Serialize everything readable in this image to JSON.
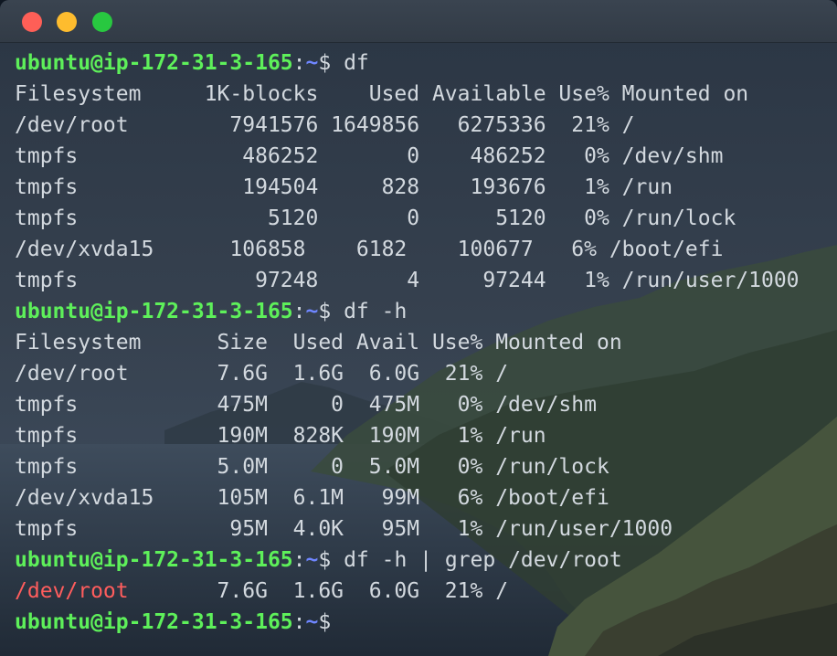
{
  "window": {
    "buttons": [
      "close",
      "minimize",
      "maximize"
    ],
    "colors": {
      "close": "#fe5f57",
      "minimize": "#febc2e",
      "maximize": "#28c840"
    }
  },
  "colors": {
    "prompt_user": "#5ef05a",
    "prompt_path": "#6f86ff",
    "text": "#d3d9df",
    "grep_match": "#ff5d5d"
  },
  "prompt": {
    "user_host": "ubuntu@ip-172-31-3-165",
    "colon": ":",
    "path": "~",
    "dollar": "$"
  },
  "lines": [
    {
      "type": "cmd",
      "command": " df"
    },
    {
      "type": "out",
      "text": "Filesystem     1K-blocks    Used Available Use% Mounted on"
    },
    {
      "type": "out",
      "text": "/dev/root        7941576 1649856   6275336  21% /"
    },
    {
      "type": "out",
      "text": "tmpfs             486252       0    486252   0% /dev/shm"
    },
    {
      "type": "out",
      "text": "tmpfs             194504     828    193676   1% /run"
    },
    {
      "type": "out",
      "text": "tmpfs               5120       0      5120   0% /run/lock"
    },
    {
      "type": "out",
      "text": "/dev/xvda15      106858    6182    100677   6% /boot/efi"
    },
    {
      "type": "out",
      "text": "tmpfs              97248       4     97244   1% /run/user/1000"
    },
    {
      "type": "cmd",
      "command": " df -h"
    },
    {
      "type": "out",
      "text": "Filesystem      Size  Used Avail Use% Mounted on"
    },
    {
      "type": "out",
      "text": "/dev/root       7.6G  1.6G  6.0G  21% /"
    },
    {
      "type": "out",
      "text": "tmpfs           475M     0  475M   0% /dev/shm"
    },
    {
      "type": "out",
      "text": "tmpfs           190M  828K  190M   1% /run"
    },
    {
      "type": "out",
      "text": "tmpfs           5.0M     0  5.0M   0% /run/lock"
    },
    {
      "type": "out",
      "text": "/dev/xvda15     105M  6.1M   99M   6% /boot/efi"
    },
    {
      "type": "out",
      "text": "tmpfs            95M  4.0K   95M   1% /run/user/1000"
    },
    {
      "type": "cmd",
      "command": " df -h | grep /dev/root"
    },
    {
      "type": "match",
      "match": "/dev/root",
      "rest": "       7.6G  1.6G  6.0G  21% /"
    },
    {
      "type": "cmd",
      "command": ""
    }
  ]
}
